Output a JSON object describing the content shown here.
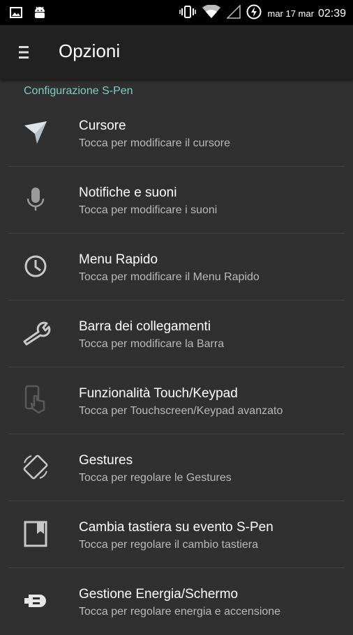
{
  "status": {
    "date": "mar 17 mar",
    "time": "02:39"
  },
  "toolbar": {
    "title": "Opzioni",
    "menu_icon": "hamburger-icon"
  },
  "section": {
    "header": "Configurazione S-Pen"
  },
  "items": [
    {
      "title": "Cursore",
      "subtitle": "Tocca per modificare il cursore",
      "icon": "cursor-icon"
    },
    {
      "title": "Notifiche e suoni",
      "subtitle": "Tocca per modificare i suoni",
      "icon": "microphone-icon"
    },
    {
      "title": "Menu Rapido",
      "subtitle": "Tocca per modificare il Menu Rapido",
      "icon": "clock-icon"
    },
    {
      "title": "Barra dei collegamenti",
      "subtitle": "Tocca per modificare la Barra",
      "icon": "wrench-icon"
    },
    {
      "title": "Funzionalità Touch/Keypad",
      "subtitle": "Tocca per Touchscreen/Keypad avanzato",
      "icon": "touch-phone-icon"
    },
    {
      "title": "Gestures",
      "subtitle": "Tocca per regolare le Gestures",
      "icon": "rotate-screen-icon"
    },
    {
      "title": "Cambia tastiera su evento S-Pen",
      "subtitle": "Tocca per regolare il cambio tastiera",
      "icon": "bookmark-icon"
    },
    {
      "title": "Gestione Energia/Schermo",
      "subtitle": "Tocca per regolare energia e accensione",
      "icon": "power-plug-icon"
    }
  ],
  "colors": {
    "background": "#303030",
    "toolbar": "#212121",
    "accent": "#7ecfc3",
    "subtitle": "#b9b9b9"
  }
}
